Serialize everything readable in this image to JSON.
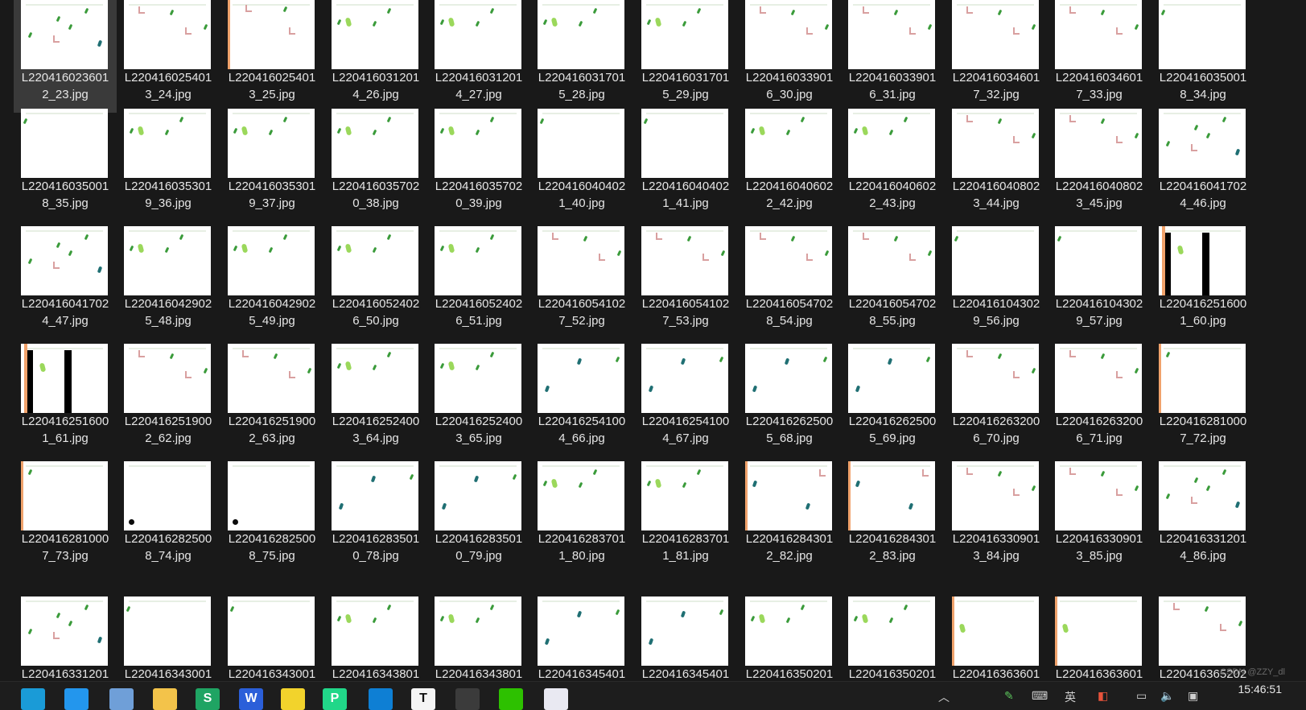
{
  "files": [
    "L220416023601\n2_23.jpg",
    "L220416025401\n3_24.jpg",
    "L220416025401\n3_25.jpg",
    "L220416031201\n4_26.jpg",
    "L220416031201\n4_27.jpg",
    "L220416031701\n5_28.jpg",
    "L220416031701\n5_29.jpg",
    "L220416033901\n6_30.jpg",
    "L220416033901\n6_31.jpg",
    "L220416034601\n7_32.jpg",
    "L220416034601\n7_33.jpg",
    "L220416035001\n8_34.jpg",
    "L220416035001\n8_35.jpg",
    "L220416035301\n9_36.jpg",
    "L220416035301\n9_37.jpg",
    "L220416035702\n0_38.jpg",
    "L220416035702\n0_39.jpg",
    "L220416040402\n1_40.jpg",
    "L220416040402\n1_41.jpg",
    "L220416040602\n2_42.jpg",
    "L220416040602\n2_43.jpg",
    "L220416040802\n3_44.jpg",
    "L220416040802\n3_45.jpg",
    "L220416041702\n4_46.jpg",
    "L220416041702\n4_47.jpg",
    "L220416042902\n5_48.jpg",
    "L220416042902\n5_49.jpg",
    "L220416052402\n6_50.jpg",
    "L220416052402\n6_51.jpg",
    "L220416054102\n7_52.jpg",
    "L220416054102\n7_53.jpg",
    "L220416054702\n8_54.jpg",
    "L220416054702\n8_55.jpg",
    "L220416104302\n9_56.jpg",
    "L220416104302\n9_57.jpg",
    "L220416251600\n1_60.jpg",
    "L220416251600\n1_61.jpg",
    "L220416251900\n2_62.jpg",
    "L220416251900\n2_63.jpg",
    "L220416252400\n3_64.jpg",
    "L220416252400\n3_65.jpg",
    "L220416254100\n4_66.jpg",
    "L220416254100\n4_67.jpg",
    "L220416262500\n5_68.jpg",
    "L220416262500\n5_69.jpg",
    "L220416263200\n6_70.jpg",
    "L220416263200\n6_71.jpg",
    "L220416281000\n7_72.jpg",
    "L220416281000\n7_73.jpg",
    "L220416282500\n8_74.jpg",
    "L220416282500\n8_75.jpg",
    "L220416283501\n0_78.jpg",
    "L220416283501\n0_79.jpg",
    "L220416283701\n1_80.jpg",
    "L220416283701\n1_81.jpg",
    "L220416284301\n2_82.jpg",
    "L220416284301\n2_83.jpg",
    "L220416330901\n3_84.jpg",
    "L220416330901\n3_85.jpg",
    "L220416331201\n4_86.jpg",
    "L220416331201",
    "L220416343001",
    "L220416343001",
    "L220416343801",
    "L220416343801",
    "L220416345401",
    "L220416345401",
    "L220416350201",
    "L220416350201",
    "L220416363601",
    "L220416363601",
    "L220416365202"
  ],
  "selected_index": 0,
  "thumb_styles": [
    "scatter",
    "bugs",
    "edge-bugs",
    "leaves",
    "leaves",
    "leaves",
    "leaves",
    "bugs",
    "bugs",
    "bugs",
    "bugs",
    "plain",
    "plain",
    "leaves",
    "leaves",
    "leaves",
    "leaves",
    "plain",
    "plain",
    "leaves",
    "leaves",
    "bugs",
    "bugs",
    "scatter",
    "scatter",
    "leaves",
    "leaves",
    "leaves",
    "leaves",
    "bugs",
    "bugs",
    "bugs",
    "bugs",
    "plain",
    "plain",
    "black-bar",
    "black-bar",
    "bugs",
    "bugs",
    "leaves",
    "leaves",
    "teal",
    "teal",
    "teal",
    "teal",
    "bugs",
    "bugs",
    "edge",
    "edge",
    "blob",
    "blob",
    "teal",
    "teal",
    "leaves",
    "leaves",
    "edge-teal",
    "edge-teal",
    "bugs",
    "bugs",
    "scatter",
    "scatter",
    "plain",
    "plain",
    "leaves",
    "leaves",
    "teal",
    "teal",
    "leaves",
    "leaves",
    "edge-lg",
    "edge-lg",
    "bugs"
  ],
  "taskbar": {
    "apps": [
      {
        "name": "edge-icon",
        "label": "",
        "color": "#1a9bd7"
      },
      {
        "name": "docker-icon",
        "label": "",
        "color": "#2396ed"
      },
      {
        "name": "finder-icon",
        "label": "",
        "color": "#6f9fd8"
      },
      {
        "name": "folder-icon",
        "label": "",
        "color": "#f3c34a"
      },
      {
        "name": "wps-sheet-icon",
        "label": "S",
        "color": "#1fa463"
      },
      {
        "name": "word-icon",
        "label": "W",
        "color": "#2b5fd9"
      },
      {
        "name": "sticky-notes-icon",
        "label": "",
        "color": "#f2d32c"
      },
      {
        "name": "pycharm-icon",
        "label": "P",
        "color": "#21d789"
      },
      {
        "name": "vscode-icon",
        "label": "",
        "color": "#0e7fd4"
      },
      {
        "name": "typora-icon",
        "label": "T",
        "color": "#f5f5f5"
      },
      {
        "name": "terminal-icon",
        "label": "",
        "color": "#3b3b3b"
      },
      {
        "name": "wechat-icon",
        "label": "",
        "color": "#2dc100"
      },
      {
        "name": "app-icon",
        "label": "",
        "color": "#e9e9f2"
      }
    ],
    "ime": "英",
    "clock": "15:46:51",
    "watermark": "CSDN @ZZY_dl"
  }
}
